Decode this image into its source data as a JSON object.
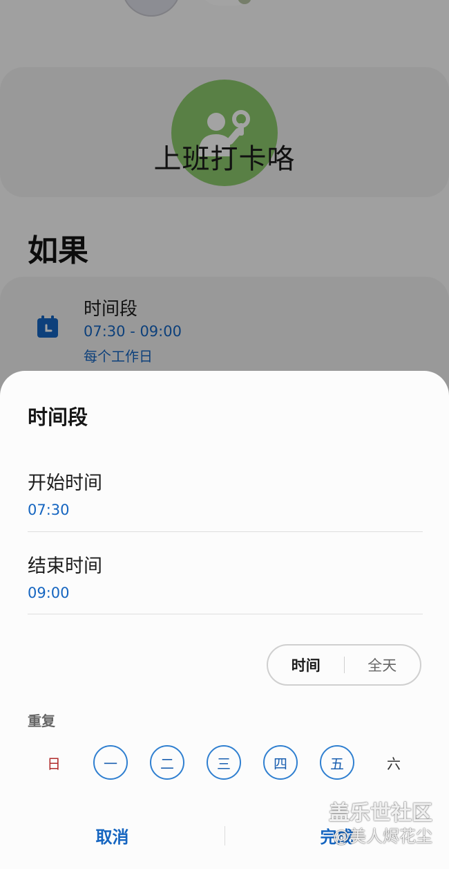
{
  "background": {
    "routine_title": "上班打卡咯",
    "if_heading": "如果",
    "condition": {
      "name": "时间段",
      "time_range": "07:30 - 09:00",
      "repeat": "每个工作日"
    },
    "icons": {
      "routine": "person-raised-hand-icon",
      "condition": "calendar-clock-icon"
    },
    "colors": {
      "routine_icon_bg": "#8bc96c",
      "accent": "#1565c0"
    }
  },
  "sheet": {
    "title": "时间段",
    "start": {
      "label": "开始时间",
      "value": "07:30"
    },
    "end": {
      "label": "结束时间",
      "value": "09:00"
    },
    "mode": {
      "time": "时间",
      "all_day": "全天",
      "selected": "时间"
    },
    "repeat_label": "重复",
    "days": [
      {
        "label": "日",
        "selected": false
      },
      {
        "label": "一",
        "selected": true
      },
      {
        "label": "二",
        "selected": true
      },
      {
        "label": "三",
        "selected": true
      },
      {
        "label": "四",
        "selected": true
      },
      {
        "label": "五",
        "selected": true
      },
      {
        "label": "六",
        "selected": false
      }
    ],
    "cancel": "取消",
    "done": "完成"
  },
  "watermark": {
    "line1": "盖乐世社区",
    "line2": "@美人烬花尘"
  }
}
